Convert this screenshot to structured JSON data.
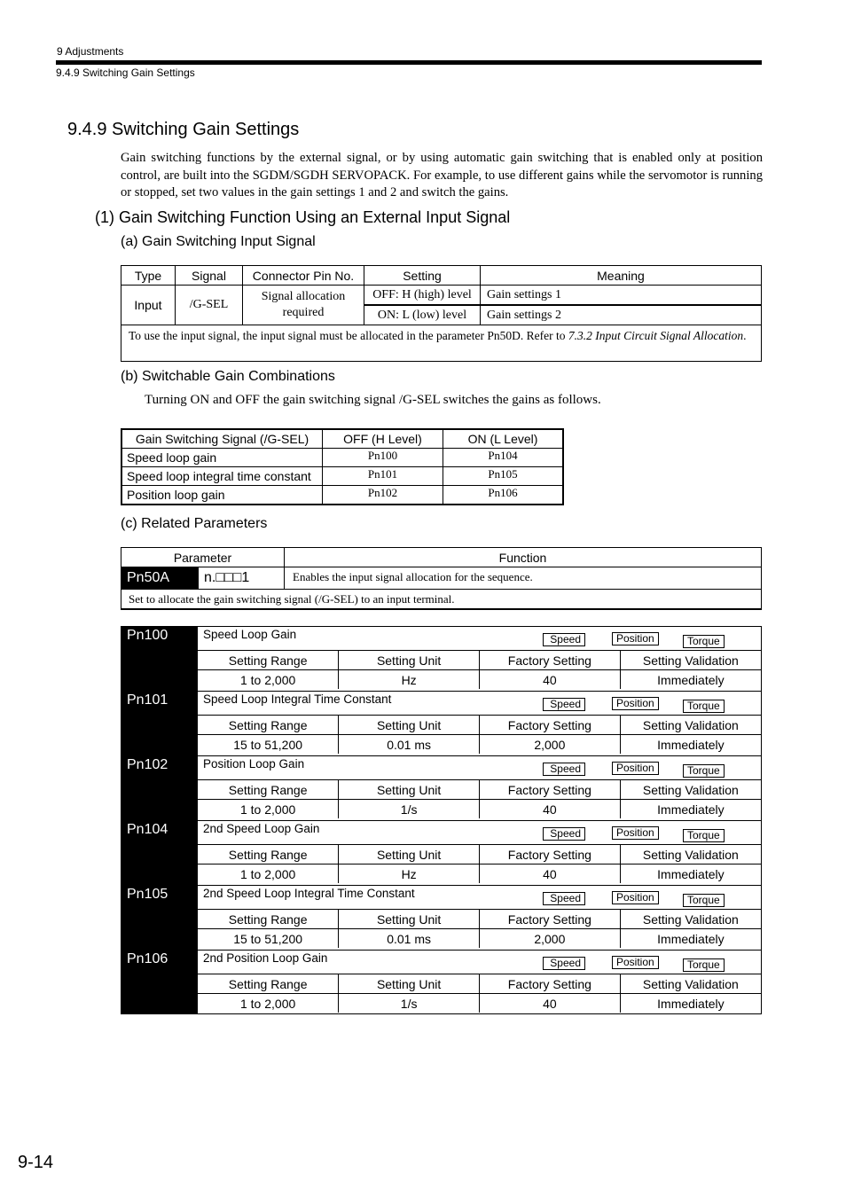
{
  "header": {
    "chapter": "9  Adjustments",
    "section": "9.4.9  Switching Gain Settings"
  },
  "section_title": "9.4.9  Switching Gain Settings",
  "intro": "Gain switching functions by the external signal, or by using automatic gain switching that is enabled only at position control, are built into the SGDM/SGDH SERVOPACK.  For example, to use different gains while the servomotor is running or stopped, set two values in the gain settings 1 and 2 and switch the gains.",
  "subsection1": "(1) Gain Switching Function Using an External Input Signal",
  "sub_a": {
    "title": "(a) Gain Switching Input Signal",
    "headers": [
      "Type",
      "Signal",
      "Connector Pin No.",
      "Setting",
      "Meaning"
    ],
    "type": "Input",
    "signal": "/G-SEL",
    "pin": "Signal allocation required",
    "rows": [
      {
        "setting": "OFF: H (high) level",
        "meaning": "Gain settings 1"
      },
      {
        "setting": "ON: L (low) level",
        "meaning": "Gain settings 2"
      }
    ],
    "note_text": "To use the input signal, the input signal must be allocated in the parameter Pn50D.  Refer to ",
    "note_ref": "7.3.2 Input Circuit Signal Allocation",
    "note_end": "."
  },
  "sub_b": {
    "title": "(b) Switchable Gain Combinations",
    "text": "Turning ON and OFF the gain switching signal /G-SEL switches the gains as follows.",
    "headers": [
      "Gain Switching Signal (/G-SEL)",
      "OFF (H Level)",
      "ON (L Level)"
    ],
    "rows": [
      {
        "label": "Speed loop gain",
        "off": "Pn100",
        "on": "Pn104"
      },
      {
        "label": "Speed loop integral time constant",
        "off": "Pn101",
        "on": "Pn105"
      },
      {
        "label": "Position loop gain",
        "off": "Pn102",
        "on": "Pn106"
      }
    ]
  },
  "sub_c": {
    "title": "(c) Related Parameters",
    "headers": [
      "Parameter",
      "Function"
    ],
    "param": "Pn50A",
    "value": "n.□□□1",
    "function": "Enables the input signal allocation for the sequence.",
    "note": "Set to allocate the gain switching signal (/G-SEL) to an input terminal."
  },
  "param_headers": [
    "Setting Range",
    "Setting Unit",
    "Factory Setting",
    "Setting Validation"
  ],
  "modes": [
    "Speed",
    "Position",
    "Torque"
  ],
  "params": [
    {
      "id": "Pn100",
      "name": "Speed Loop Gain",
      "range": "1 to 2,000",
      "unit": "Hz",
      "factory": "40",
      "validation": "Immediately"
    },
    {
      "id": "Pn101",
      "name": "Speed Loop Integral Time Constant",
      "range": "15 to 51,200",
      "unit": "0.01 ms",
      "factory": "2,000",
      "validation": "Immediately"
    },
    {
      "id": "Pn102",
      "name": "Position Loop Gain",
      "range": "1 to 2,000",
      "unit": "1/s",
      "factory": "40",
      "validation": "Immediately"
    },
    {
      "id": "Pn104",
      "name": "2nd Speed Loop Gain",
      "range": "1 to 2,000",
      "unit": "Hz",
      "factory": "40",
      "validation": "Immediately"
    },
    {
      "id": "Pn105",
      "name": "2nd Speed Loop Integral Time Constant",
      "range": "15 to 51,200",
      "unit": "0.01 ms",
      "factory": "2,000",
      "validation": "Immediately"
    },
    {
      "id": "Pn106",
      "name": "2nd Position Loop Gain",
      "range": "1 to 2,000",
      "unit": "1/s",
      "factory": "40",
      "validation": "Immediately"
    }
  ],
  "page_number": "9-14"
}
